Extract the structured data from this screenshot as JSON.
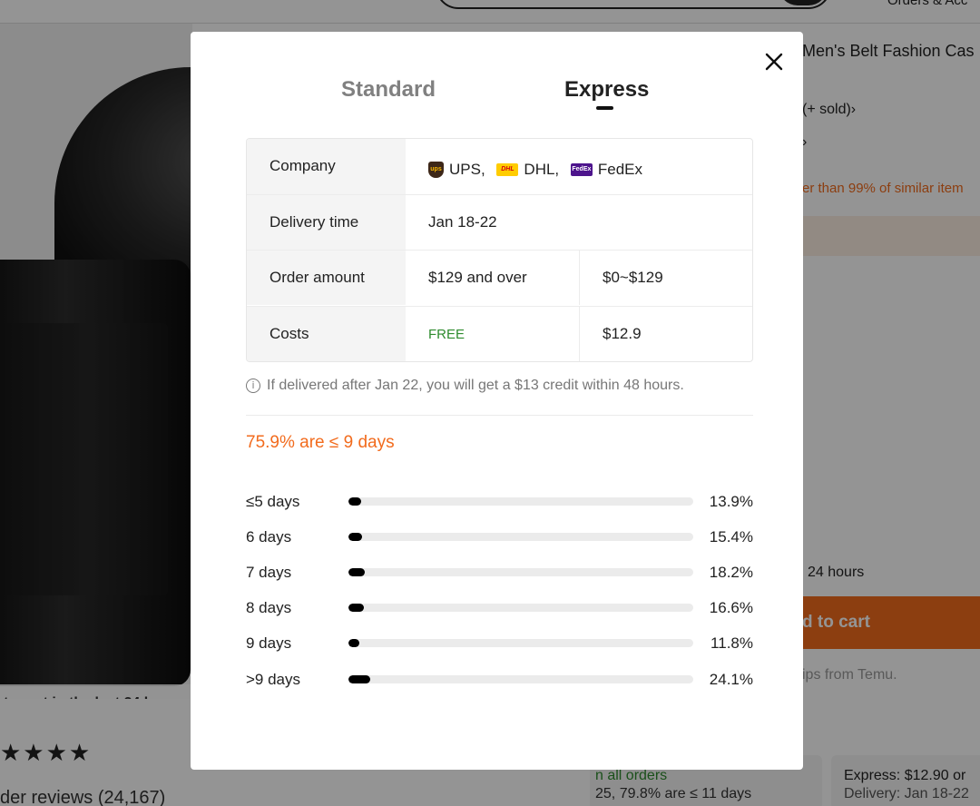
{
  "background": {
    "orders_link": "Orders & Acc",
    "product_title": "Men's Belt Fashion Cas",
    "sold_text": "(+ sold)›",
    "chevron": "›",
    "cheaper_text": "er than 99% of similar item",
    "hours_text": "24 hours",
    "add_to_cart_label": "d to cart",
    "ships_from": "ips from Temu.",
    "image_caption": "to cart in the last 24 hour",
    "stars": "★★★★",
    "reviews": "der reviews (24,167)",
    "orders_box_line1": "n all orders",
    "orders_box_line2": "25, 79.8% are ≤ 11 days",
    "express_box_line1": "Express: $12.90 or",
    "express_box_line2": "Delivery: Jan 18-22"
  },
  "modal": {
    "close_icon": "close-icon",
    "tabs": [
      {
        "label": "Standard",
        "active": false
      },
      {
        "label": "Express",
        "active": true
      }
    ],
    "table": {
      "company_label": "Company",
      "carriers": [
        {
          "icon": "ups-logo",
          "name": "UPS,"
        },
        {
          "icon": "dhl-logo",
          "name": "DHL,"
        },
        {
          "icon": "fedex-logo",
          "name": "FedEx"
        }
      ],
      "delivery_label": "Delivery time",
      "delivery_value": "Jan 18-22",
      "order_amount_label": "Order amount",
      "order_amount_col1": "$129 and over",
      "order_amount_col2": "$0~$129",
      "costs_label": "Costs",
      "costs_col1": "FREE",
      "costs_col2": "$12.9"
    },
    "credit_note": "If delivered after Jan 22, you will get a $13 credit within 48 hours.",
    "headline": "75.9% are ≤ 9 days",
    "distribution": [
      {
        "label": "≤5 days",
        "value": "13.9%",
        "fraction": 0.139
      },
      {
        "label": "6 days",
        "value": "15.4%",
        "fraction": 0.154
      },
      {
        "label": "7 days",
        "value": "18.2%",
        "fraction": 0.182
      },
      {
        "label": "8 days",
        "value": "16.6%",
        "fraction": 0.166
      },
      {
        "label": "9 days",
        "value": "11.8%",
        "fraction": 0.118
      },
      {
        "label": ">9 days",
        "value": "24.1%",
        "fraction": 0.241
      }
    ]
  },
  "colors": {
    "accent_orange": "#f26b1d",
    "free_green": "#2e8b2e",
    "bar_fill": "#000000",
    "bar_track": "#ebebeb"
  }
}
